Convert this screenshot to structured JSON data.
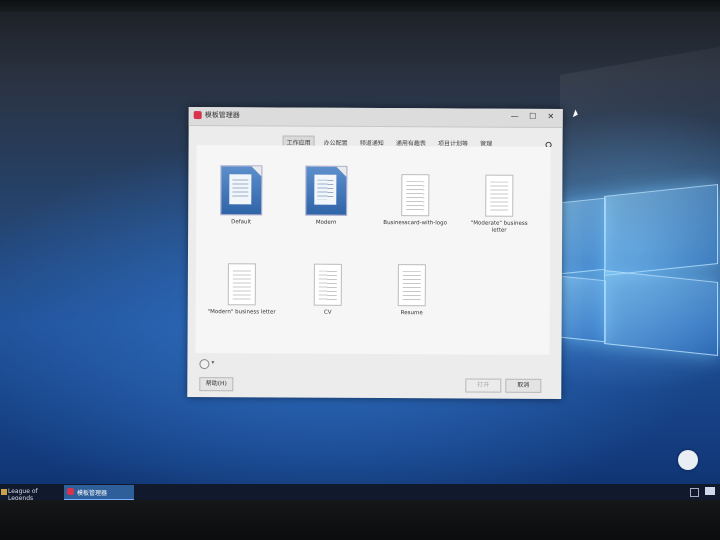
{
  "dialog": {
    "title": "模板管理器",
    "window_controls": {
      "minimize": "—",
      "maximize": "☐",
      "close": "✕"
    },
    "tabs": [
      {
        "label": "工作应用",
        "active": true
      },
      {
        "label": "办公配置",
        "active": false
      },
      {
        "label": "频道通知",
        "active": false
      },
      {
        "label": "通用有趣表",
        "active": false
      },
      {
        "label": "项目计划等",
        "active": false
      },
      {
        "label": "管理",
        "active": false
      }
    ],
    "templates": [
      {
        "label": "Default",
        "icon": "libreoffice-writer-icon"
      },
      {
        "label": "Modern",
        "icon": "libreoffice-writer-icon"
      },
      {
        "label": "Businesscard-with-logo",
        "icon": "document-thumbnail"
      },
      {
        "label": "\"Moderate\" business letter",
        "icon": "document-thumbnail"
      },
      {
        "label": "\"Modern\" business letter",
        "icon": "document-thumbnail"
      },
      {
        "label": "CV",
        "icon": "document-thumbnail"
      },
      {
        "label": "Resume",
        "icon": "document-thumbnail"
      }
    ],
    "bottom_mark": "▾",
    "buttons": {
      "help": "帮助(H)",
      "open": "打开",
      "cancel": "取消"
    }
  },
  "taskbar": {
    "items": [
      {
        "label": "League of Legends"
      },
      {
        "label": "模板管理器"
      }
    ]
  },
  "colors": {
    "accent": "#2e5f9a",
    "app_icon": "#d8344c"
  }
}
